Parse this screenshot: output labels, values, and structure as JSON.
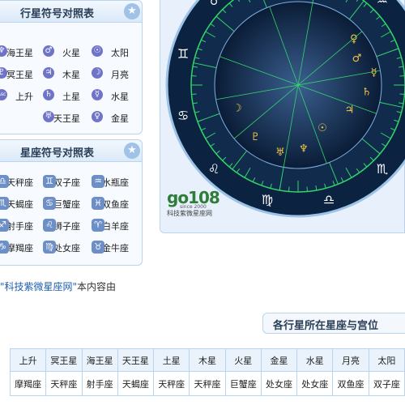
{
  "planet_panel": {
    "title": "行星符号对照表",
    "rows": [
      [
        {
          "name": "太阳",
          "sym": "☉"
        },
        {
          "name": "火星",
          "sym": "♂"
        },
        {
          "name": "海王星",
          "sym": "♆"
        }
      ],
      [
        {
          "name": "月亮",
          "sym": "☽"
        },
        {
          "name": "木星",
          "sym": "♃"
        },
        {
          "name": "冥王星",
          "sym": "♇"
        }
      ],
      [
        {
          "name": "水星",
          "sym": "☿"
        },
        {
          "name": "土星",
          "sym": "♄"
        },
        {
          "name": "上升",
          "sym": "Asc"
        }
      ],
      [
        {
          "name": "金星",
          "sym": "♀"
        },
        {
          "name": "天王星",
          "sym": "♅"
        },
        {
          "name": "",
          "sym": ""
        }
      ]
    ]
  },
  "zodiac_panel": {
    "title": "星座符号对照表",
    "rows": [
      [
        {
          "name": "水瓶座",
          "sym": "♒"
        },
        {
          "name": "双子座",
          "sym": "♊"
        },
        {
          "name": "天秤座",
          "sym": "♎"
        }
      ],
      [
        {
          "name": "双鱼座",
          "sym": "♓"
        },
        {
          "name": "巨蟹座",
          "sym": "♋"
        },
        {
          "name": "天蝎座",
          "sym": "♏"
        }
      ],
      [
        {
          "name": "白羊座",
          "sym": "♈"
        },
        {
          "name": "狮子座",
          "sym": "♌"
        },
        {
          "name": "射手座",
          "sym": "♐"
        }
      ],
      [
        {
          "name": "金牛座",
          "sym": "♉"
        },
        {
          "name": "处女座",
          "sym": "♍"
        },
        {
          "name": "摩羯座",
          "sym": "♑"
        }
      ]
    ]
  },
  "chart": {
    "ring_signs": [
      "♊",
      "♋",
      "♌",
      "♍",
      "♎",
      "♏",
      "♐",
      "♑",
      "♒",
      "♓",
      "♈",
      "♉"
    ],
    "planet_glyphs": [
      "♀",
      "♂",
      "☿",
      "♄",
      "♃",
      "☉",
      "♆",
      "♅",
      "♇",
      "☽"
    ],
    "logo_text": "go108",
    "logo_sub": "科技紫微星座网",
    "logo_year": "since 2000"
  },
  "credit": {
    "prefix": "本内容由",
    "link": "\"科技紫微星座网\""
  },
  "section": {
    "title": "各行星所在星座与宫位"
  },
  "table": {
    "headers": [
      "太阳",
      "月亮",
      "水星",
      "金星",
      "火星",
      "木星",
      "土星",
      "天王星",
      "海王星",
      "冥王星",
      "上升"
    ],
    "row": [
      "双子座",
      "双鱼座",
      "处女座",
      "处女座",
      "巨蟹座",
      "天秤座",
      "天秤座",
      "天蝎座",
      "射手座",
      "天秤座",
      "摩羯座"
    ]
  },
  "colors": {
    "accent": "#6f74c9",
    "border": "#b8d4ee",
    "header_bg": "#dbe9f8",
    "wheel_dark": "#0b2240",
    "wheel_line": "#32d46a"
  }
}
